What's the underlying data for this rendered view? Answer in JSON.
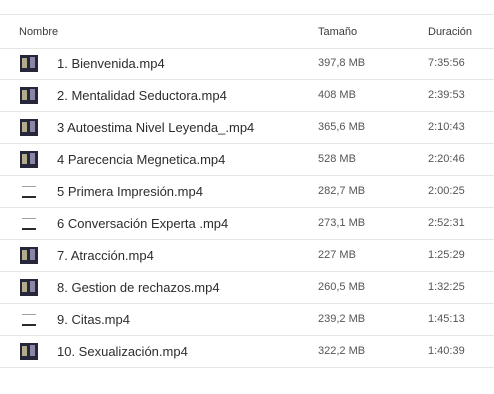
{
  "header": {
    "name": "Nombre",
    "size": "Tamaño",
    "duration": "Duración"
  },
  "files": [
    {
      "name": "1. Bienvenida.mp4",
      "size": "397,8 MB",
      "duration": "7:35:56",
      "thumb": "dark"
    },
    {
      "name": "2. Mentalidad Seductora.mp4",
      "size": "408 MB",
      "duration": "2:39:53",
      "thumb": "dark"
    },
    {
      "name": "3 Autoestima Nivel Leyenda_.mp4",
      "size": "365,6 MB",
      "duration": "2:10:43",
      "thumb": "dark"
    },
    {
      "name": "4 Parecencia Megnetica.mp4",
      "size": "528 MB",
      "duration": "2:20:46",
      "thumb": "dark"
    },
    {
      "name": "5 Primera Impresión.mp4",
      "size": "282,7 MB",
      "duration": "2:00:25",
      "thumb": "light"
    },
    {
      "name": "6 Conversación Experta .mp4",
      "size": "273,1 MB",
      "duration": "2:52:31",
      "thumb": "light"
    },
    {
      "name": "7. Atracción.mp4",
      "size": "227 MB",
      "duration": "1:25:29",
      "thumb": "dark"
    },
    {
      "name": "8. Gestion de rechazos.mp4",
      "size": "260,5 MB",
      "duration": "1:32:25",
      "thumb": "dark"
    },
    {
      "name": "9. Citas.mp4",
      "size": "239,2 MB",
      "duration": "1:45:13",
      "thumb": "light"
    },
    {
      "name": "10. Sexualización.mp4",
      "size": "322,2 MB",
      "duration": "1:40:39",
      "thumb": "dark"
    }
  ]
}
